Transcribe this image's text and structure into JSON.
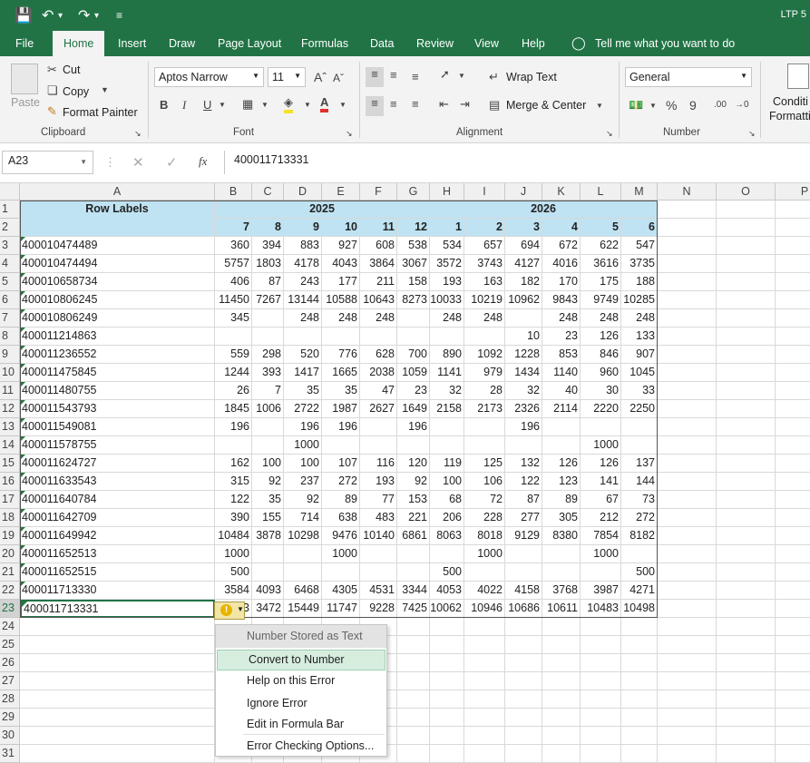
{
  "titlebar": {
    "doc_title": "LTP 5"
  },
  "tabs": [
    "File",
    "Home",
    "Insert",
    "Draw",
    "Page Layout",
    "Formulas",
    "Data",
    "Review",
    "View",
    "Help",
    "Tell me what you want to do"
  ],
  "ribbon": {
    "clipboard": {
      "paste": "Paste",
      "cut": "Cut",
      "copy": "Copy",
      "format_painter": "Format Painter",
      "label": "Clipboard"
    },
    "font": {
      "name": "Aptos Narrow",
      "size": "11",
      "bold": "B",
      "italic": "I",
      "underline": "U",
      "label": "Font"
    },
    "alignment": {
      "wrap_text": "Wrap Text",
      "merge_center": "Merge & Center",
      "label": "Alignment"
    },
    "number": {
      "format": "General",
      "percent": "%",
      "comma": "9",
      "inc_dec": ".00",
      "label": "Number"
    },
    "styles": {
      "cond_line1": "Conditi",
      "cond_line2": "Formatti"
    }
  },
  "formula_bar": {
    "name_box": "A23",
    "fx": "fx",
    "formula": "400011713331"
  },
  "columns": [
    "A",
    "B",
    "C",
    "D",
    "E",
    "F",
    "G",
    "H",
    "I",
    "J",
    "K",
    "L",
    "M",
    "N",
    "O",
    "P"
  ],
  "row_numbers": [
    "1",
    "2",
    "3",
    "4",
    "5",
    "6",
    "7",
    "8",
    "9",
    "10",
    "11",
    "12",
    "13",
    "14",
    "15",
    "16",
    "17",
    "18",
    "19",
    "20",
    "21",
    "22",
    "23",
    "24",
    "25",
    "26",
    "27",
    "28",
    "29",
    "30",
    "31"
  ],
  "header": {
    "row_labels": "Row Labels",
    "year1": "2025",
    "year2": "2026",
    "months": [
      "7",
      "8",
      "9",
      "10",
      "11",
      "12",
      "1",
      "2",
      "3",
      "4",
      "5",
      "6"
    ]
  },
  "rows": [
    [
      "400010474489",
      "360",
      "394",
      "883",
      "927",
      "608",
      "538",
      "534",
      "657",
      "694",
      "672",
      "622",
      "547"
    ],
    [
      "400010474494",
      "5757",
      "1803",
      "4178",
      "4043",
      "3864",
      "3067",
      "3572",
      "3743",
      "4127",
      "4016",
      "3616",
      "3735"
    ],
    [
      "400010658734",
      "406",
      "87",
      "243",
      "177",
      "211",
      "158",
      "193",
      "163",
      "182",
      "170",
      "175",
      "188"
    ],
    [
      "400010806245",
      "11450",
      "7267",
      "13144",
      "10588",
      "10643",
      "8273",
      "10033",
      "10219",
      "10962",
      "9843",
      "9749",
      "10285"
    ],
    [
      "400010806249",
      "345",
      "",
      "248",
      "248",
      "248",
      "",
      "248",
      "248",
      "",
      "248",
      "248",
      "248"
    ],
    [
      "400011214863",
      "",
      "",
      "",
      "",
      "",
      "",
      "",
      "",
      "10",
      "23",
      "126",
      "133"
    ],
    [
      "400011236552",
      "559",
      "298",
      "520",
      "776",
      "628",
      "700",
      "890",
      "1092",
      "1228",
      "853",
      "846",
      "907"
    ],
    [
      "400011475845",
      "1244",
      "393",
      "1417",
      "1665",
      "2038",
      "1059",
      "1141",
      "979",
      "1434",
      "1140",
      "960",
      "1045"
    ],
    [
      "400011480755",
      "26",
      "7",
      "35",
      "35",
      "47",
      "23",
      "32",
      "28",
      "32",
      "40",
      "30",
      "33"
    ],
    [
      "400011543793",
      "1845",
      "1006",
      "2722",
      "1987",
      "2627",
      "1649",
      "2158",
      "2173",
      "2326",
      "2114",
      "2220",
      "2250"
    ],
    [
      "400011549081",
      "196",
      "",
      "196",
      "196",
      "",
      "196",
      "",
      "",
      "196",
      "",
      "",
      ""
    ],
    [
      "400011578755",
      "",
      "",
      "1000",
      "",
      "",
      "",
      "",
      "",
      "",
      "",
      "1000",
      ""
    ],
    [
      "400011624727",
      "162",
      "100",
      "100",
      "107",
      "116",
      "120",
      "119",
      "125",
      "132",
      "126",
      "126",
      "137"
    ],
    [
      "400011633543",
      "315",
      "92",
      "237",
      "272",
      "193",
      "92",
      "100",
      "106",
      "122",
      "123",
      "141",
      "144"
    ],
    [
      "400011640784",
      "122",
      "35",
      "92",
      "89",
      "77",
      "153",
      "68",
      "72",
      "87",
      "89",
      "67",
      "73"
    ],
    [
      "400011642709",
      "390",
      "155",
      "714",
      "638",
      "483",
      "221",
      "206",
      "228",
      "277",
      "305",
      "212",
      "272"
    ],
    [
      "400011649942",
      "10484",
      "3878",
      "10298",
      "9476",
      "10140",
      "6861",
      "8063",
      "8018",
      "9129",
      "8380",
      "7854",
      "8182"
    ],
    [
      "400011652513",
      "1000",
      "",
      "",
      "1000",
      "",
      "",
      "",
      "1000",
      "",
      "",
      "1000",
      ""
    ],
    [
      "400011652515",
      "500",
      "",
      "",
      "",
      "",
      "",
      "500",
      "",
      "",
      "",
      "",
      "500"
    ],
    [
      "400011713330",
      "3584",
      "4093",
      "6468",
      "4305",
      "4531",
      "3344",
      "4053",
      "4022",
      "4158",
      "3768",
      "3987",
      "4271"
    ],
    [
      "400011713331",
      "3",
      "3472",
      "15449",
      "11747",
      "9228",
      "7425",
      "10062",
      "10946",
      "10686",
      "10611",
      "10483",
      "10498"
    ]
  ],
  "error_menu": {
    "title": "Number Stored as Text",
    "items": [
      "Convert to Number",
      "Help on this Error",
      "Ignore Error",
      "Edit in Formula Bar",
      "Error Checking Options..."
    ]
  },
  "colors": {
    "excel_green": "#217346",
    "header_blue": "#bfe3f2",
    "menu_highlight": "#d7eedf"
  }
}
